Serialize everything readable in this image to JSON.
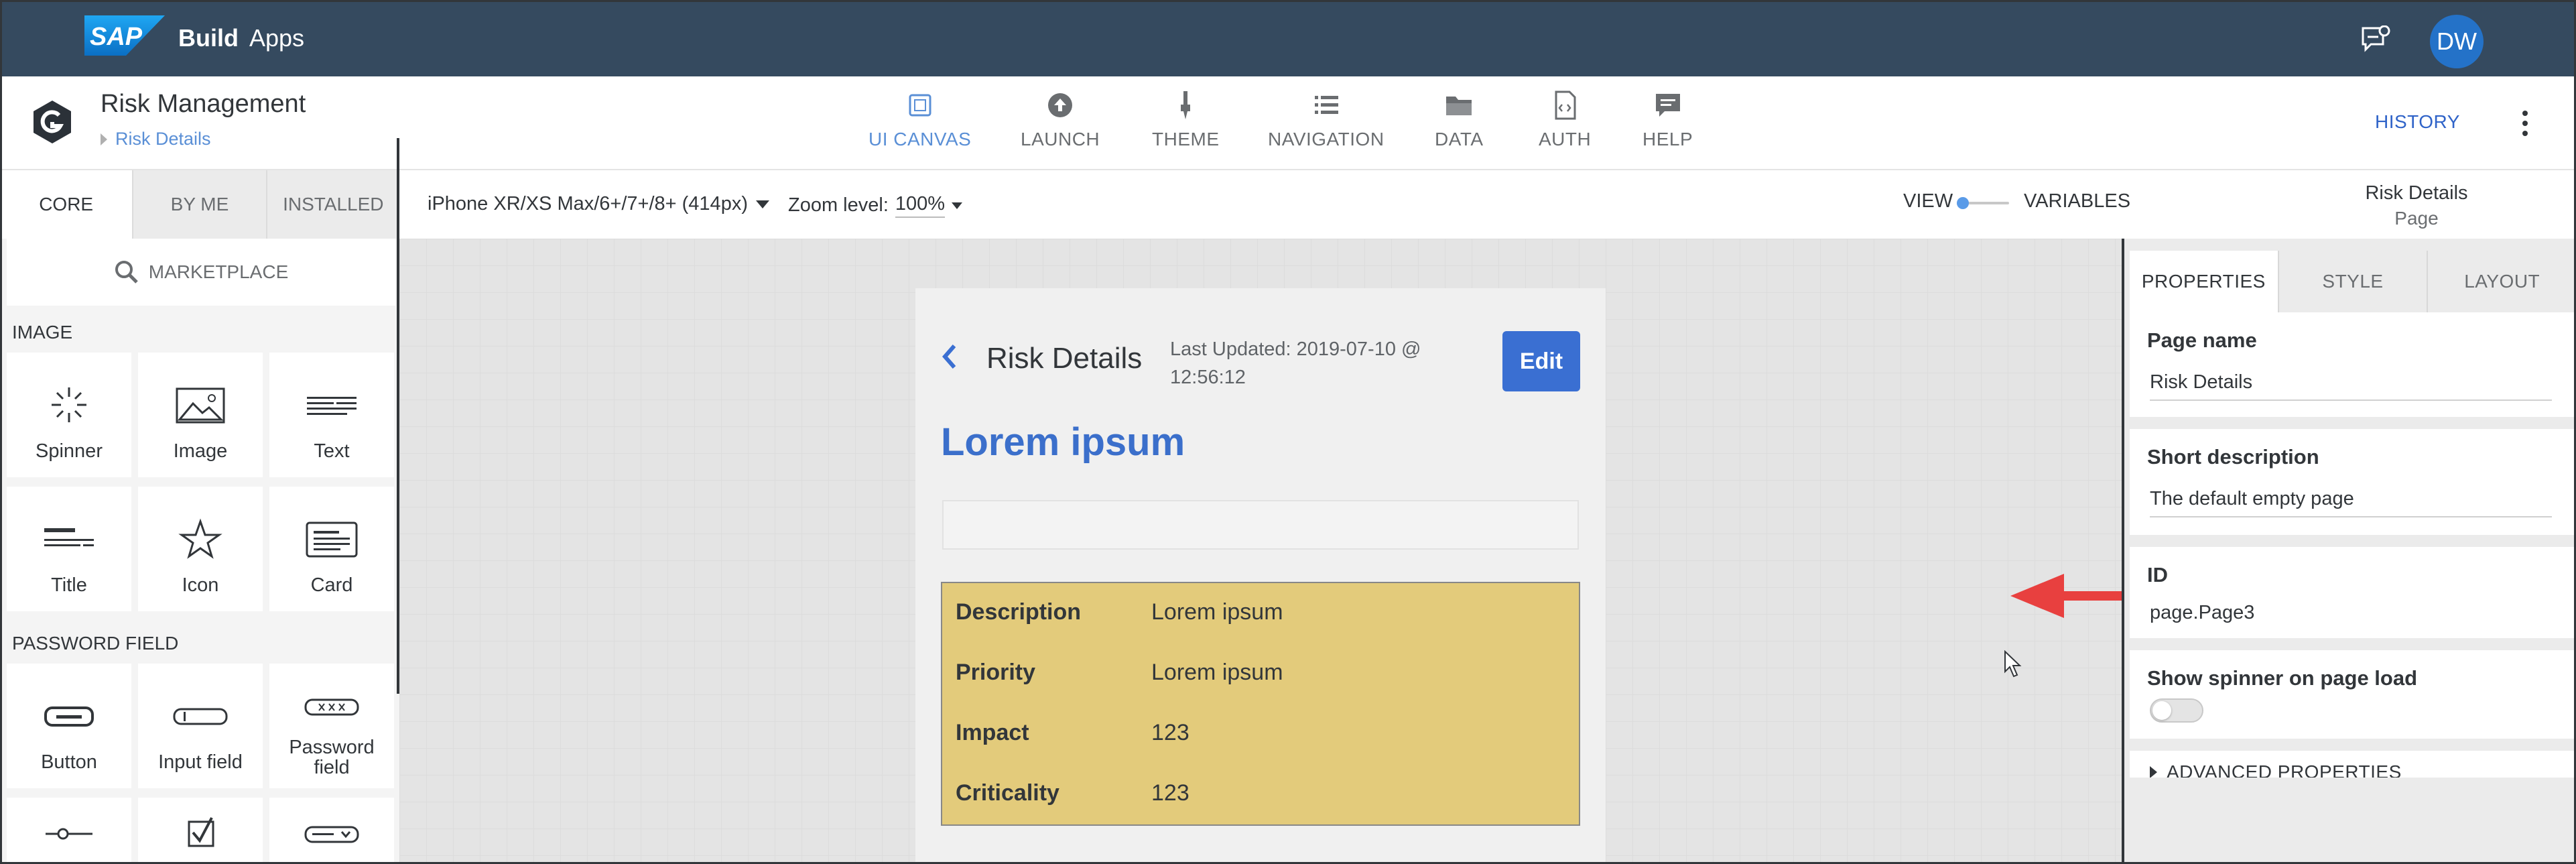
{
  "shell": {
    "brand_logo": "SAP",
    "title_bold": "Build",
    "title_rest": "Apps",
    "feedback_icon": "feedback-chat-icon",
    "avatar_initials": "DW",
    "bg_color": "#354a5f"
  },
  "app": {
    "title": "Risk Management",
    "breadcrumb": "Risk Details",
    "nav_tabs": [
      {
        "label": "UI CANVAS",
        "icon": "canvas-icon",
        "active": true
      },
      {
        "label": "LAUNCH",
        "icon": "upload-icon",
        "active": false
      },
      {
        "label": "THEME",
        "icon": "brush-icon",
        "active": false
      },
      {
        "label": "NAVIGATION",
        "icon": "list-icon",
        "active": false
      },
      {
        "label": "DATA",
        "icon": "folder-icon",
        "active": false
      },
      {
        "label": "AUTH",
        "icon": "code-file-icon",
        "active": false
      },
      {
        "label": "HELP",
        "icon": "help-chat-icon",
        "active": false
      }
    ],
    "history_label": "HISTORY"
  },
  "left_panel": {
    "tabs": [
      "CORE",
      "BY ME",
      "INSTALLED"
    ],
    "marketplace_label": "MARKETPLACE",
    "sections": [
      {
        "title": "IMAGE",
        "tiles": [
          "Spinner",
          "Image",
          "Text",
          "Title",
          "Icon",
          "Card"
        ]
      },
      {
        "title": "PASSWORD FIELD",
        "tiles": [
          "Button",
          "Input field",
          "Password field"
        ]
      }
    ]
  },
  "toolbar": {
    "device": "iPhone XR/XS Max/6+/7+/8+ (414px)",
    "zoom_label": "Zoom level:",
    "zoom_value": "100%",
    "view_label": "VIEW",
    "variables_label": "VARIABLES",
    "page_title": "Risk Details",
    "page_type": "Page"
  },
  "phone": {
    "title": "Risk Details",
    "last_updated": "Last Updated: 2019-07-10 @ 12:56:12",
    "edit_label": "Edit",
    "heading": "Lorem ipsum",
    "card_rows": [
      {
        "key": "Description",
        "value": "Lorem ipsum"
      },
      {
        "key": "Priority",
        "value": "Lorem ipsum"
      },
      {
        "key": "Impact",
        "value": "123"
      },
      {
        "key": "Criticality",
        "value": "123"
      }
    ],
    "accent_color": "#3a6fd2",
    "card_color": "#e3cb7b"
  },
  "right_panel": {
    "tabs": [
      "PROPERTIES",
      "STYLE",
      "LAYOUT"
    ],
    "page_name_label": "Page name",
    "page_name_value": "Risk Details",
    "short_desc_label": "Short description",
    "short_desc_value": "The default empty page",
    "id_label": "ID",
    "id_value": "page.Page3",
    "spinner_label": "Show spinner on page load",
    "spinner_enabled": false,
    "advanced_label": "ADVANCED PROPERTIES"
  },
  "annotation": {
    "arrow_color": "#e8403f"
  }
}
